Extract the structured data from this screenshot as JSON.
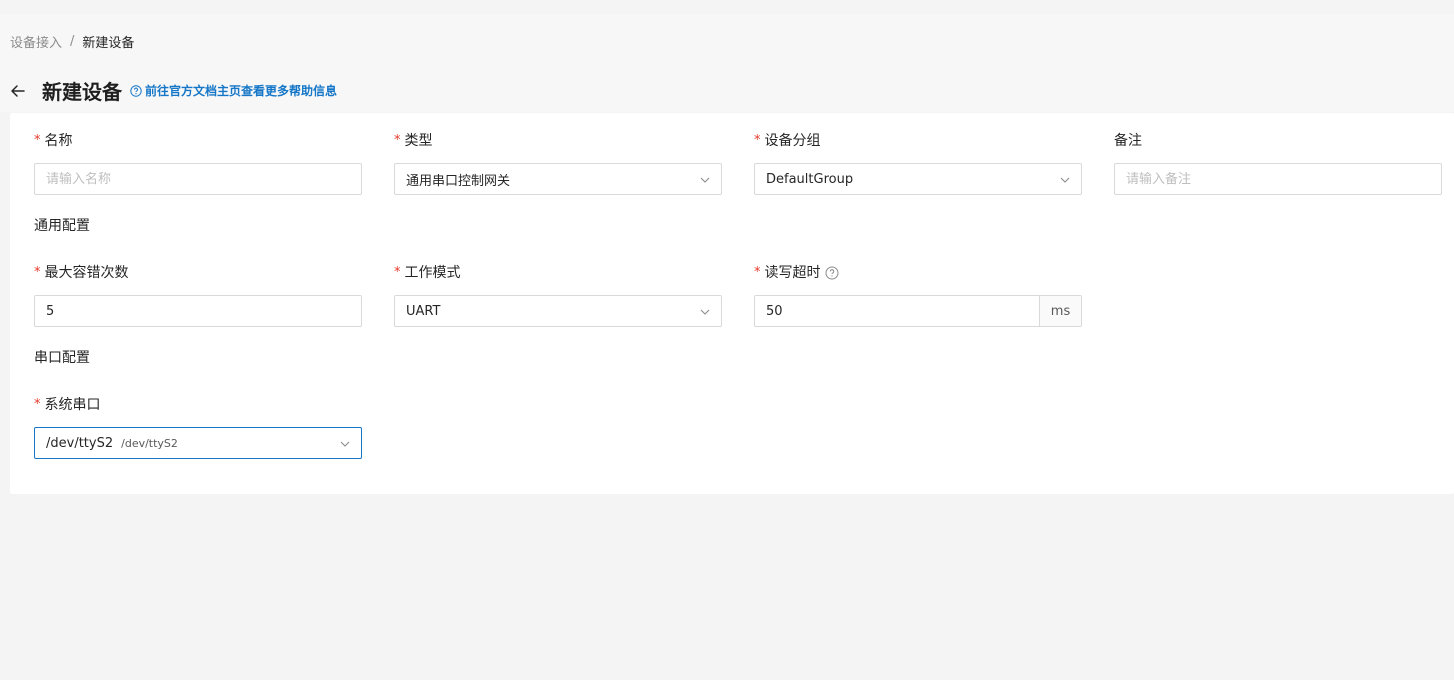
{
  "breadcrumb": {
    "parent": "设备接入",
    "separator": "/",
    "current": "新建设备"
  },
  "header": {
    "title": "新建设备",
    "help_link": "前往官方文档主页查看更多帮助信息"
  },
  "form": {
    "name": {
      "label": "名称",
      "placeholder": "请输入名称",
      "value": ""
    },
    "type": {
      "label": "类型",
      "value": "通用串口控制网关"
    },
    "group": {
      "label": "设备分组",
      "value": "DefaultGroup"
    },
    "remark": {
      "label": "备注",
      "placeholder": "请输入备注",
      "value": ""
    },
    "general_section": "通用配置",
    "max_retry": {
      "label": "最大容错次数",
      "value": "5"
    },
    "work_mode": {
      "label": "工作模式",
      "value": "UART"
    },
    "rw_timeout": {
      "label": "读写超时",
      "value": "50",
      "unit": "ms"
    },
    "serial_section": "串口配置",
    "sys_serial": {
      "label": "系统串口",
      "value": "/dev/ttyS2",
      "sub": "/dev/ttyS2"
    }
  },
  "colors": {
    "accent": "#1677c8",
    "required": "#e3392b"
  }
}
